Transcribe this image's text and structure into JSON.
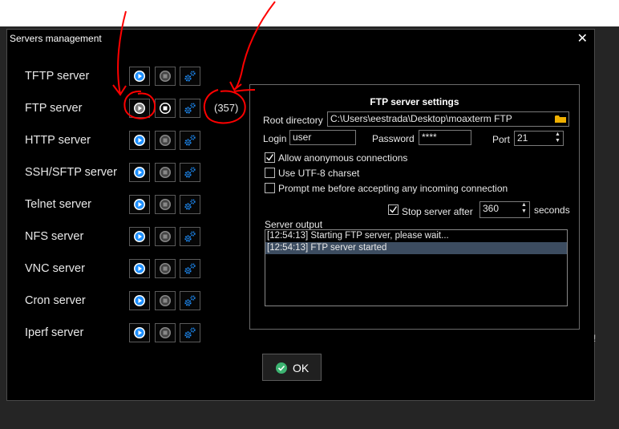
{
  "dialog": {
    "title": "Servers management",
    "close_glyph": "✕"
  },
  "servers": [
    {
      "label": "TFTP server",
      "running": false
    },
    {
      "label": "FTP server",
      "running": true,
      "count": "(357)"
    },
    {
      "label": "HTTP server",
      "running": false
    },
    {
      "label": "SSH/SFTP server",
      "running": false
    },
    {
      "label": "Telnet server",
      "running": false
    },
    {
      "label": "NFS server",
      "running": false
    },
    {
      "label": "VNC server",
      "running": false
    },
    {
      "label": "Cron server",
      "running": false
    },
    {
      "label": "Iperf server",
      "running": false
    }
  ],
  "ftp": {
    "title": "FTP server settings",
    "root_label": "Root directory",
    "root_value": "C:\\Users\\eestrada\\Desktop\\moaxterm FTP",
    "login_label": "Login",
    "login_value": "user",
    "password_label": "Password",
    "password_value": "****",
    "port_label": "Port",
    "port_value": "21",
    "anon_label": "Allow anonymous connections",
    "anon_checked": true,
    "utf8_label": "Use UTF-8 charset",
    "utf8_checked": false,
    "prompt_label": "Prompt me before accepting any incoming connection",
    "prompt_checked": false,
    "stop_label": "Stop server after",
    "stop_checked": true,
    "stop_value": "360",
    "stop_unit": "seconds",
    "output_label": "Server output",
    "output_lines": [
      "[12:54:13] Starting FTP server, please wait...",
      "[12:54:13] FTP server started"
    ]
  },
  "ok_label": "OK",
  "stray_char": "!",
  "colors": {
    "accent_blue": "#1e90ff",
    "ok_green": "#3cb371",
    "annotation_red": "#ff0000",
    "selection": "#3c4c60",
    "folder": "#f0b000"
  },
  "icons": {
    "start": "play-circle-icon",
    "stop": "stop-circle-icon",
    "settings": "gears-icon",
    "browse": "folder-icon",
    "ok": "check-circle-icon"
  }
}
